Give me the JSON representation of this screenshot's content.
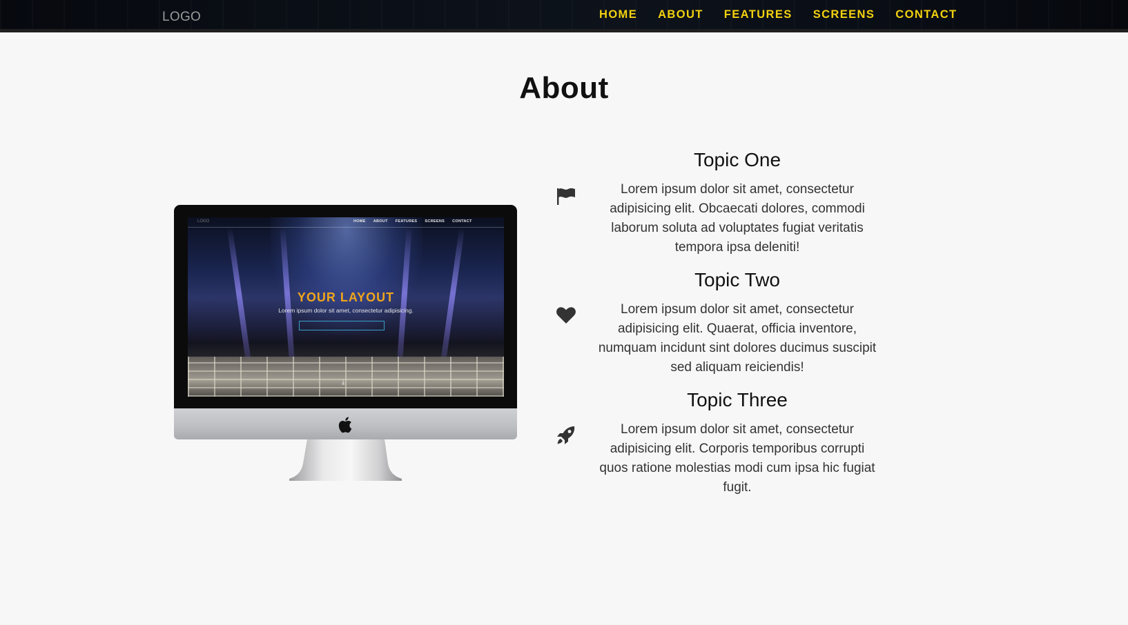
{
  "nav": {
    "logo": "LOGO",
    "links": [
      "HOME",
      "ABOUT",
      "FEATURES",
      "SCREENS",
      "CONTACT"
    ],
    "link_color": "#f3d20f"
  },
  "about": {
    "title": "About"
  },
  "mockup": {
    "screen_logo": "LOGO",
    "screen_links": [
      "HOME",
      "ABOUT",
      "FEATURES",
      "SCREENS",
      "CONTACT"
    ],
    "headline": "YOUR LAYOUT",
    "subline": "Lorem ipsum dolor sit amet, consectetur adipisicing.",
    "headline_color": "#f1a51b",
    "device_logo_icon": "apple-logo-icon"
  },
  "topics": [
    {
      "icon": "flag-icon",
      "title": "Topic One",
      "text": "Lorem ipsum dolor sit amet, consectetur adipisicing elit. Obcaecati dolores, commodi laborum soluta ad voluptates fugiat veritatis tempora ipsa deleniti!"
    },
    {
      "icon": "heart-icon",
      "title": "Topic Two",
      "text": "Lorem ipsum dolor sit amet, consectetur adipisicing elit. Quaerat, officia inventore, numquam incidunt sint dolores ducimus suscipit sed aliquam reiciendis!"
    },
    {
      "icon": "rocket-icon",
      "title": "Topic Three",
      "text": "Lorem ipsum dolor sit amet, consectetur adipisicing elit. Corporis temporibus corrupti quos ratione molestias modi cum ipsa hic fugiat fugit."
    }
  ]
}
